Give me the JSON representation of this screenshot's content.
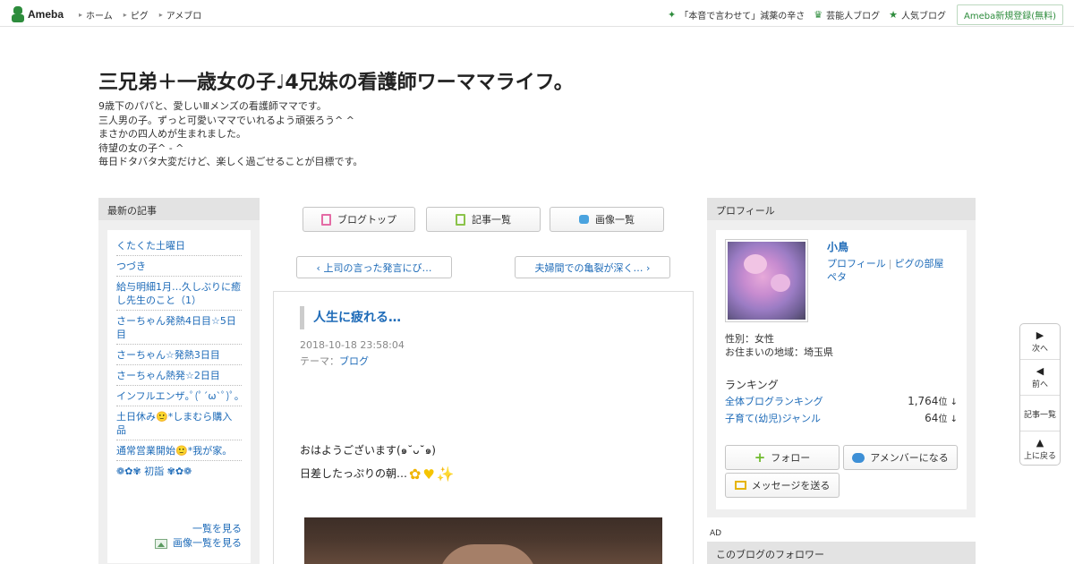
{
  "topbar": {
    "logo_text": "Ameba",
    "nav": [
      {
        "label": "ホーム"
      },
      {
        "label": "ピグ"
      },
      {
        "label": "アメブロ"
      }
    ],
    "right_links": [
      {
        "label": "「本音で言わせて」減薬の辛さ",
        "icon": "sparkle-icon"
      },
      {
        "label": "芸能人ブログ",
        "icon": "crown-icon"
      },
      {
        "label": "人気ブログ",
        "icon": "star-icon"
      }
    ],
    "register_label": "Ameba新規登録(無料)"
  },
  "header": {
    "title": "三兄弟＋一歳女の子♩4兄妹の看護師ワーママライフ。",
    "description": [
      "9歳下のパパと、愛しいⅢメンズの看護師ママです。",
      "三人男の子。ずっと可愛いママでいれるよう頑張ろう^ ^",
      "まさかの四人めが生まれました。",
      "待望の女の子^ - ^",
      "毎日ドタバタ大変だけど、楽しく過ごせることが目標です。"
    ]
  },
  "left_sidebar": {
    "heading": "最新の記事",
    "items": [
      {
        "label": "くたくた土曜日"
      },
      {
        "label": "つづき"
      },
      {
        "label": "給与明細1月…久しぶりに癒し先生のこと（1）"
      },
      {
        "label": "さーちゃん発熱4日目☆5日目"
      },
      {
        "label": "さーちゃん☆発熱3日目"
      },
      {
        "label": "さーちゃん熱発☆2日目"
      },
      {
        "label": "インフルエンザ｡ﾟ(ﾟ´ω`ﾟ)ﾟ｡"
      },
      {
        "label": "土日休み🙂*しまむら購入品"
      },
      {
        "label": "通常営業開始🙂*我が家。"
      },
      {
        "label": "❁✿✾ 初詣 ✾✿❁"
      }
    ],
    "more_label": "一覧を見る",
    "image_list_label": "画像一覧を見る"
  },
  "center": {
    "nav_buttons": [
      {
        "label": "ブログトップ",
        "icon": "document-icon",
        "color": "#e46ba5"
      },
      {
        "label": "記事一覧",
        "icon": "list-icon",
        "color": "#8bc34a"
      },
      {
        "label": "画像一覧",
        "icon": "camera-icon",
        "color": "#4aa3df"
      }
    ],
    "prev_label": "‹ 上司の言った発言にび…",
    "next_label": "夫婦間での亀裂が深く… ›",
    "article": {
      "title": "人生に疲れる…",
      "date": "2018-10-18 23:58:04",
      "theme_prefix": "テーマ：",
      "theme": "ブログ",
      "body_line1": "おはようございます(๑˘ᴗ˘๑)",
      "body_line2": "日差したっぷりの朝…",
      "emojis": [
        "flower-icon",
        "heart-icon",
        "sparkles-icon"
      ]
    }
  },
  "right_sidebar": {
    "heading": "プロフィール",
    "name": "小鳥",
    "links": [
      "プロフィール",
      "ピグの部屋",
      "ペタ"
    ],
    "gender": "性別：女性",
    "area": "お住まいの地域：埼玉県",
    "ranking_heading": "ランキング",
    "rankings": [
      {
        "label": "全体ブログランキング",
        "value": "1,764",
        "unit": "位 ↓"
      },
      {
        "label": "子育て(幼児)ジャンル",
        "value": "64",
        "unit": "位 ↓"
      }
    ],
    "follow_label": "フォロー",
    "amember_label": "アメンバーになる",
    "message_label": "メッセージを送る",
    "ad_label": "AD",
    "followers_heading": "このブログのフォロワー"
  },
  "float_nav": {
    "next": "次へ",
    "prev": "前へ",
    "list": "記事一覧",
    "top": "上に戻る"
  },
  "colors": {
    "accent_green": "#2d8c3c",
    "link_blue": "#1e6bb8"
  }
}
